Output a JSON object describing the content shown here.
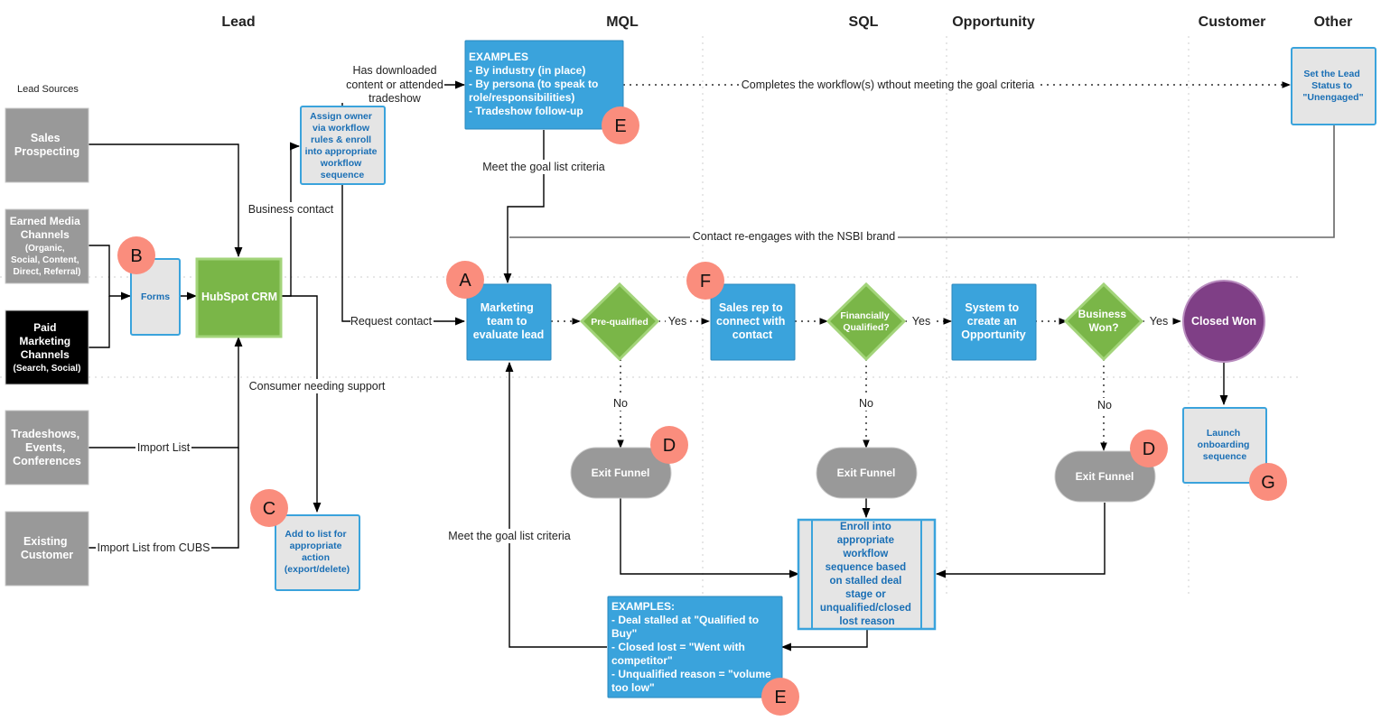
{
  "colors": {
    "source_gray": "#999999",
    "source_black": "#000000",
    "process_blue": "#3aa3dc",
    "note_fill": "#e5e5e5",
    "note_border": "#3aa3dc",
    "note_text": "#1a6fb5",
    "decision_green": "#7ab648",
    "decision_border": "#a3d47a",
    "terminal_gray": "#999999",
    "closed_won_purple": "#7f3f86",
    "closed_won_border": "#b98dbf",
    "badge_salmon": "#fa8d7d",
    "edge": "#000000",
    "lane_divider": "#cfcfcf"
  },
  "lanes": [
    "Lead",
    "MQL",
    "SQL",
    "Opportunity",
    "Customer",
    "Other"
  ],
  "lead_sources_label": "Lead Sources",
  "sources": {
    "sales_prospecting": [
      "Sales",
      "Prospecting"
    ],
    "earned_media": [
      "Earned Media",
      "Channels",
      "(Organic,",
      "Social, Content,",
      "Direct, Referral)"
    ],
    "paid_marketing": [
      "Paid",
      "Marketing",
      "Channels",
      "(Search, Social)"
    ],
    "tradeshows": [
      "Tradeshows,",
      "Events,",
      "Conferences"
    ],
    "existing_customer": [
      "Existing",
      "Customer"
    ]
  },
  "nodes": {
    "forms": [
      "Forms"
    ],
    "hubspot_crm": [
      "HubSpot CRM"
    ],
    "assign_owner": [
      "Assign owner",
      "via workflow",
      "rules & enroll",
      "into appropriate",
      "workflow",
      "sequence"
    ],
    "add_to_list": [
      "Add to list for",
      "appropriate",
      "action",
      "(export/delete)"
    ],
    "examples_top": [
      "EXAMPLES",
      "- By industry (in place)",
      "- By persona (to speak to",
      "role/responsibilities)",
      "- Tradeshow follow-up"
    ],
    "marketing_team": [
      "Marketing",
      "team to",
      "evaluate lead"
    ],
    "pre_qualified": [
      "Pre-qualified"
    ],
    "sales_rep": [
      "Sales rep to",
      "connect with",
      "contact"
    ],
    "financially_qualified": [
      "Financially",
      "Qualified?"
    ],
    "system_opportunity": [
      "System to",
      "create an",
      "Opportunity"
    ],
    "business_won": [
      "Business",
      "Won?"
    ],
    "closed_won": [
      "Closed Won"
    ],
    "launch_onboarding": [
      "Launch",
      "onboarding",
      "sequence"
    ],
    "set_lead_status": [
      "Set the Lead",
      "Status to",
      "\"Unengaged\""
    ],
    "exit_funnel_1": [
      "Exit Funnel"
    ],
    "exit_funnel_2": [
      "Exit Funnel"
    ],
    "exit_funnel_3": [
      "Exit Funnel"
    ],
    "enroll_workflow": [
      "Enroll into",
      "appropriate",
      "workflow",
      "sequence based",
      "on stalled deal",
      "stage or",
      "unqualified/closed",
      "lost reason"
    ],
    "examples_bottom": [
      "EXAMPLES:",
      "- Deal stalled at \"Qualified to",
      "Buy\"",
      "- Closed lost = \"Went with",
      "competitor\"",
      "- Unqualified reason = \"volume",
      "too low\""
    ]
  },
  "edge_labels": {
    "has_downloaded": [
      "Has downloaded",
      "content or attended",
      "tradeshow"
    ],
    "business_contact": "Business contact",
    "request_contact": "Request contact",
    "consumer_support": "Consumer needing support",
    "import_list": "Import List",
    "import_list_cubs": "Import List from CUBS",
    "meet_goal_top": "Meet the goal list criteria",
    "meet_goal_bottom": "Meet the goal list criteria",
    "completes_workflow": "Completes the workflow(s) wthout meeting the goal criteria",
    "re_engages": "Contact re-engages with the NSBI brand",
    "yes_1": "Yes",
    "yes_2": "Yes",
    "yes_3": "Yes",
    "no_1": "No",
    "no_2": "No",
    "no_3": "No"
  },
  "badges": {
    "a": "A",
    "b": "B",
    "c": "C",
    "d1": "D",
    "d2": "D",
    "e1": "E",
    "e2": "E",
    "f": "F",
    "g": "G"
  }
}
